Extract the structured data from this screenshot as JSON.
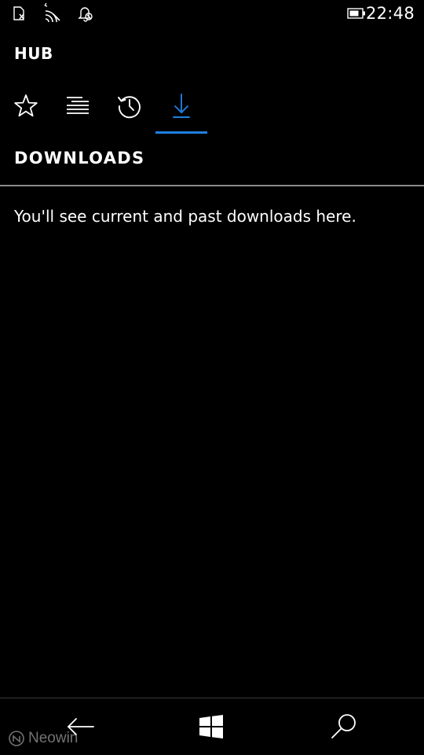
{
  "status_bar": {
    "icons": [
      "sim-card-icon",
      "wifi-signal-icon",
      "quiet-hours-icon",
      "battery-icon"
    ],
    "time": "22:48"
  },
  "header": {
    "title": "HUB"
  },
  "tabs": [
    {
      "icon": "star-icon",
      "active": false
    },
    {
      "icon": "reading-list-icon",
      "active": false
    },
    {
      "icon": "history-icon",
      "active": false
    },
    {
      "icon": "download-icon",
      "active": true
    }
  ],
  "colors": {
    "accent": "#1f7fe0",
    "background": "#000000",
    "text": "#ffffff",
    "divider": "#8a8a8a"
  },
  "section": {
    "title": "DOWNLOADS",
    "empty_message": "You'll see current and past downloads here."
  },
  "nav_bar": {
    "buttons": [
      "back-arrow-icon",
      "windows-start-icon",
      "search-icon"
    ]
  },
  "watermark": {
    "text": "Neowin"
  }
}
